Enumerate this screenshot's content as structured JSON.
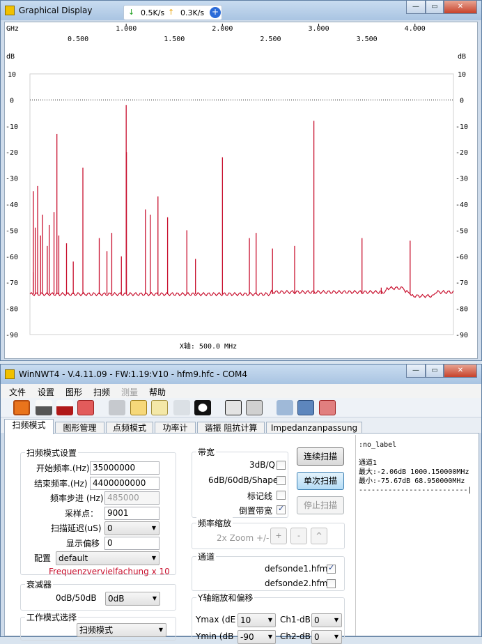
{
  "win1": {
    "title": "Graphical Display",
    "download": "0.5K/s",
    "upload": "0.3K/s"
  },
  "plot": {
    "top_unit": "GHz",
    "ghz_ticks": [
      "1.000",
      "2.000",
      "3.000",
      "4.000"
    ],
    "ghz_half_ticks": [
      "0.500",
      "1.500",
      "2.500",
      "3.500"
    ],
    "y_unit": "dB",
    "y_ticks": [
      "10",
      "0",
      "-10",
      "-20",
      "-30",
      "-40",
      "-50",
      "-60",
      "-70",
      "-80",
      "-90"
    ],
    "xaxis_label": "X轴: 500.0 MHz",
    "trace_color": "#c8102e"
  },
  "chart_data": {
    "type": "line",
    "xlabel": "X轴: 500.0 MHz",
    "ylabel": "dB",
    "ylim": [
      -90,
      10
    ],
    "xlim_ghz": [
      0,
      4.4
    ],
    "baseline_db": -74.5,
    "peaks": [
      {
        "x": 0.035,
        "db": -66
      },
      {
        "x": 0.035,
        "db": -35
      },
      {
        "x": 0.055,
        "db": -49
      },
      {
        "x": 0.08,
        "db": -33
      },
      {
        "x": 0.11,
        "db": -52
      },
      {
        "x": 0.13,
        "db": -44
      },
      {
        "x": 0.18,
        "db": -56
      },
      {
        "x": 0.2,
        "db": -48
      },
      {
        "x": 0.25,
        "db": -43
      },
      {
        "x": 0.28,
        "db": -13
      },
      {
        "x": 0.3,
        "db": -52
      },
      {
        "x": 0.38,
        "db": -55
      },
      {
        "x": 0.45,
        "db": -62
      },
      {
        "x": 0.55,
        "db": -26
      },
      {
        "x": 0.72,
        "db": -53
      },
      {
        "x": 0.8,
        "db": -58
      },
      {
        "x": 0.85,
        "db": -51
      },
      {
        "x": 0.95,
        "db": -60
      },
      {
        "x": 1.0,
        "db": -2
      },
      {
        "x": 1.003,
        "db": -20
      },
      {
        "x": 1.2,
        "db": -42
      },
      {
        "x": 1.25,
        "db": -44
      },
      {
        "x": 1.33,
        "db": -37
      },
      {
        "x": 1.43,
        "db": -45
      },
      {
        "x": 1.63,
        "db": -50
      },
      {
        "x": 1.72,
        "db": -61
      },
      {
        "x": 2.0,
        "db": -22
      },
      {
        "x": 2.28,
        "db": -53
      },
      {
        "x": 2.35,
        "db": -51
      },
      {
        "x": 2.52,
        "db": -57
      },
      {
        "x": 2.75,
        "db": -56
      },
      {
        "x": 2.95,
        "db": -8
      },
      {
        "x": 3.45,
        "db": -53
      },
      {
        "x": 3.65,
        "db": -72
      },
      {
        "x": 3.95,
        "db": -54
      }
    ]
  },
  "win2": {
    "title": "WinNWT4 - V.4.11.09 - FW:1.19:V10 - hfm9.hfc - COM4"
  },
  "menu": [
    "文件",
    "设置",
    "图形",
    "扫频",
    "测量",
    "帮助"
  ],
  "tabs": [
    "扫频模式",
    "图形管理",
    "点频模式",
    "功率计",
    "谐振 阻抗计算",
    "Impedanzanpassung"
  ],
  "sweep": {
    "group": "扫频模式设置",
    "start_label": "开始频率.(Hz)",
    "start_value": "35000000",
    "end_label": "结束频率.(Hz)",
    "end_value": "4400000000",
    "step_label": "频率步进 (Hz)",
    "step_value": "485000",
    "points_label": "采样点：",
    "points_value": "9001",
    "delay_label": "扫描延迟(uS)",
    "delay_value": "0",
    "offset_label": "显示偏移",
    "offset_value": "0",
    "config_label": "配置",
    "config_value": "default",
    "note": "Frequenzvervielfachung x 10"
  },
  "atten": {
    "group": "衰减器",
    "label": "0dB/50dB",
    "value": "0dB"
  },
  "mode": {
    "group": "工作模式选择",
    "value": "扫频模式"
  },
  "bw": {
    "group": "带宽",
    "opt1": "3dB/Q",
    "opt2": "6dB/60dB/Shape",
    "opt3": "标记线",
    "opt4": "倒置带宽"
  },
  "zoom": {
    "group": "频率缩放",
    "label": "2x Zoom +/-",
    "b1": "+",
    "b2": "-",
    "b3": "^"
  },
  "chan": {
    "group": "通道",
    "ch1": "defsonde1.hfm",
    "ch2": "defsonde2.hfm"
  },
  "ysc": {
    "group": "Y轴缩放和偏移",
    "ymax_label": "Ymax (dE",
    "ymax_value": "10",
    "ymin_label": "Ymin (dB",
    "ymin_value": "-90",
    "ch1_label": "Ch1-dB",
    "ch1_value": "0",
    "ch2_label": "Ch2-dB",
    "ch2_value": "0"
  },
  "buttons": {
    "cont": "连续扫描",
    "single": "单次扫描",
    "stop": "停止扫描"
  },
  "output": {
    "l1": ":no_label",
    "l2": "通道1",
    "l3": "最大:-2.06dB 1000.150000MHz",
    "l4": "最小:-75.67dB 68.950000MHz",
    "l5": "--------------------------|"
  }
}
